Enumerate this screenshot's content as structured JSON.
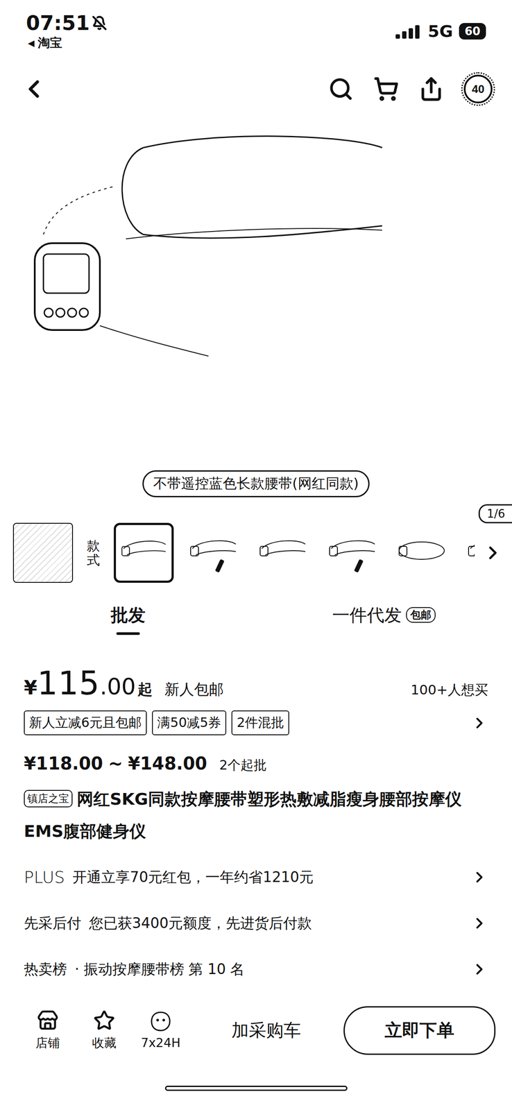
{
  "status_bar": {
    "time": "07:51",
    "back_glyph": "◀",
    "back_app": "淘宝",
    "network": "5G",
    "battery": "60"
  },
  "nav": {
    "badge": "40"
  },
  "gallery": {
    "caption": "不带遥控蓝色长款腰带(网红同款)",
    "counter": "1/6"
  },
  "variants": {
    "label": "款式",
    "items": [
      {
        "kind": "belt",
        "selected": true
      },
      {
        "kind": "belt-remote",
        "selected": false
      },
      {
        "kind": "belt",
        "selected": false
      },
      {
        "kind": "belt-remote",
        "selected": false
      },
      {
        "kind": "belt-ring",
        "selected": false
      },
      {
        "kind": "belt-remote",
        "selected": false
      }
    ]
  },
  "tabs": [
    {
      "label": "批发",
      "badge": "",
      "selected": true
    },
    {
      "label": "一件代发",
      "badge": "包邮",
      "selected": false
    }
  ],
  "price": {
    "currency": "¥",
    "int": "115",
    "dec": ".00",
    "suffix": "起",
    "note": "新人包邮",
    "wants": "100+人想买"
  },
  "coupons": [
    "新人立减6元且包邮",
    "满50减5券",
    "2件混批"
  ],
  "range": {
    "low": "¥118.00",
    "sep": "~",
    "high": "¥148.00",
    "moq": "2个起批"
  },
  "title": {
    "tag": "镇店之宝",
    "text": "网红SKG同款按摩腰带塑形热敷减脂瘦身腰部按摩仪EMS腹部健身仪"
  },
  "info_rows": [
    {
      "label": "PLUS",
      "text": "开通立享70元红包，一年约省1210元"
    },
    {
      "label": "先采后付",
      "text": "您已获3400元额度，先进货后付款"
    },
    {
      "label": "热卖榜",
      "text": "· 振动按摩腰带榜 第 10 名"
    }
  ],
  "bottom_bar": {
    "icons": [
      {
        "label": "店铺"
      },
      {
        "label": "收藏"
      },
      {
        "label": "7x24H"
      }
    ],
    "cart": "加采购车",
    "buy": "立即下单"
  }
}
